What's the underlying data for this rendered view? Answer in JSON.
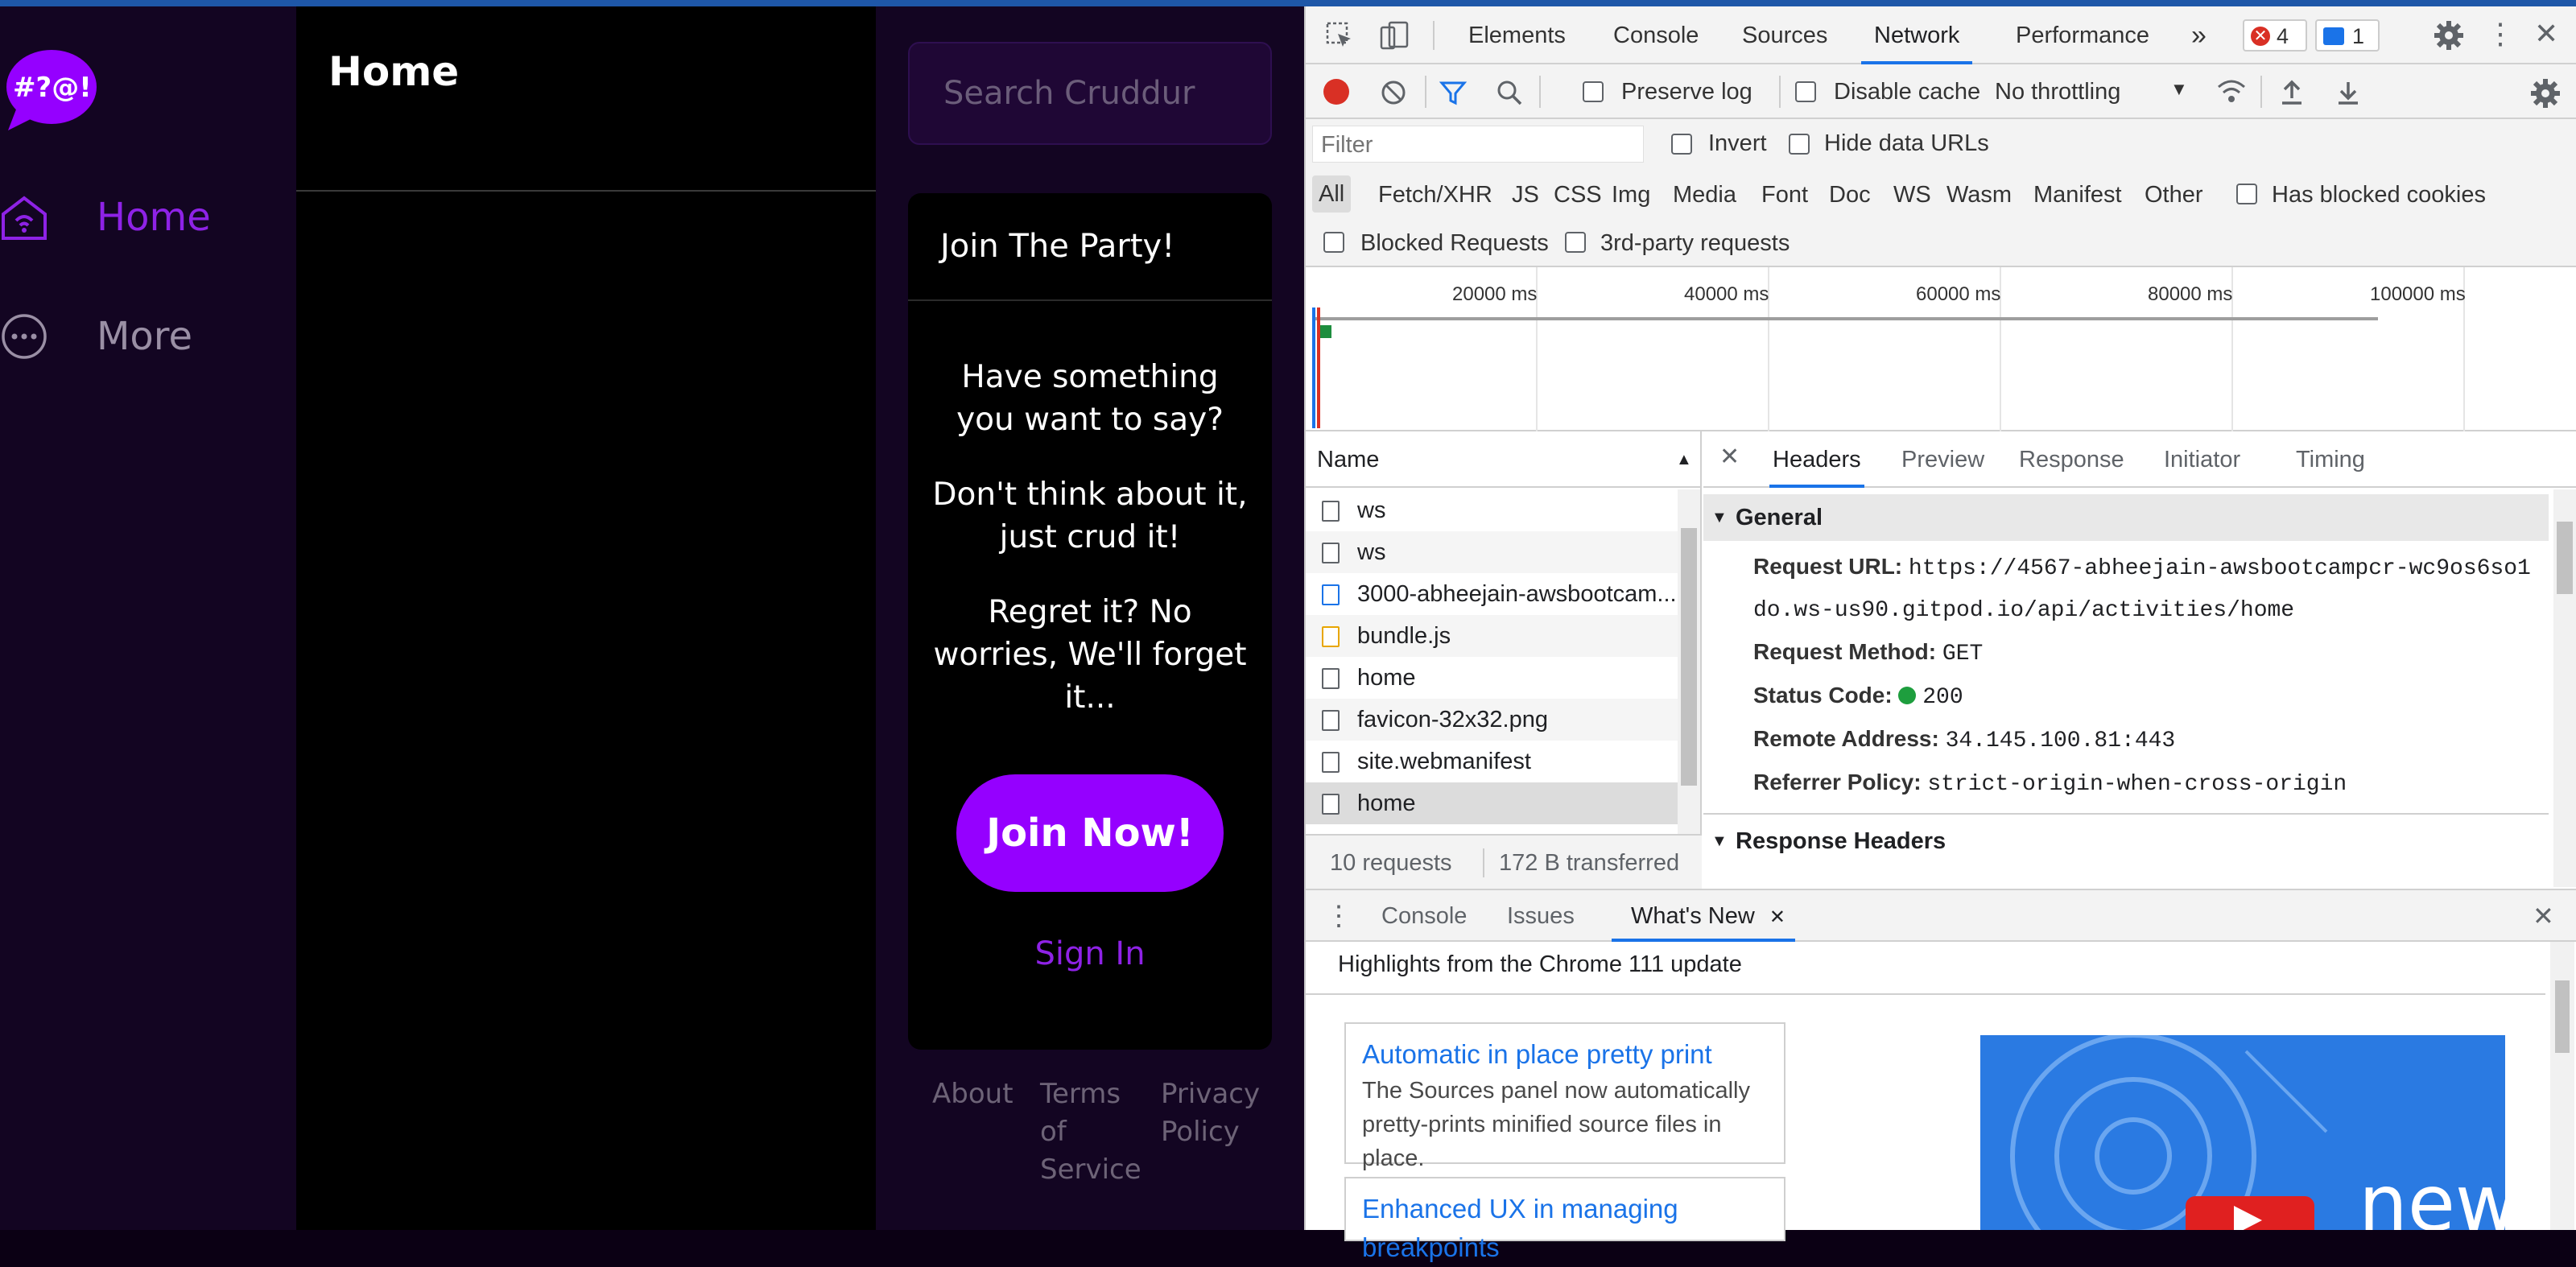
{
  "app": {
    "nav": [
      {
        "label": "Home",
        "icon": "home-icon"
      },
      {
        "label": "More",
        "icon": "more-icon"
      }
    ],
    "feed_title": "Home",
    "search_placeholder": "Search Cruddur",
    "join": {
      "title": "Join The Party!",
      "p1": "Have something you want to say?",
      "p2": "Don't think about it, just crud it!",
      "p3": "Regret it? No worries, We'll forget it...",
      "button": "Join Now!",
      "signin": "Sign In"
    },
    "footer": {
      "about": "About",
      "terms": "Terms of Service",
      "privacy": "Privacy Policy"
    },
    "colors": {
      "accent": "#9500ff",
      "purple_text": "#8e22e6"
    }
  },
  "devtools": {
    "tabs": [
      "Elements",
      "Console",
      "Sources",
      "Network",
      "Performance"
    ],
    "active_tab": "Network",
    "error_count": "4",
    "message_count": "1",
    "toolbar": {
      "preserve_log": "Preserve log",
      "disable_cache": "Disable cache",
      "throttling": "No throttling"
    },
    "filter": {
      "placeholder": "Filter",
      "invert": "Invert",
      "hide_data": "Hide data URLs"
    },
    "types": [
      "All",
      "Fetch/XHR",
      "JS",
      "CSS",
      "Img",
      "Media",
      "Font",
      "Doc",
      "WS",
      "Wasm",
      "Manifest",
      "Other"
    ],
    "has_blocked_cookies": "Has blocked cookies",
    "blocked_requests": "Blocked Requests",
    "third_party": "3rd-party requests",
    "timeline_labels": [
      "20000 ms",
      "40000 ms",
      "60000 ms",
      "80000 ms",
      "100000 ms"
    ],
    "name_header": "Name",
    "requests": [
      "ws",
      "ws",
      "3000-abheejain-awsbootcam...",
      "bundle.js",
      "home",
      "favicon-32x32.png",
      "site.webmanifest",
      "home"
    ],
    "summary_requests": "10 requests",
    "summary_transferred": "172 B transferred",
    "detail_tabs": [
      "Headers",
      "Preview",
      "Response",
      "Initiator",
      "Timing"
    ],
    "general_title": "General",
    "general": {
      "url_key": "Request URL:",
      "url_val_1": "https://4567-abheejain-awsbootcampcr-wc9os6so1",
      "url_val_2": "do.ws-us90.gitpod.io/api/activities/home",
      "method_key": "Request Method:",
      "method_val": "GET",
      "status_key": "Status Code:",
      "status_val": "200",
      "remote_key": "Remote Address:",
      "remote_val": "34.145.100.81:443",
      "referrer_key": "Referrer Policy:",
      "referrer_val": "strict-origin-when-cross-origin"
    },
    "response_headers_title": "Response Headers",
    "drawer_tabs": [
      "Console",
      "Issues",
      "What's New"
    ],
    "whats_new": {
      "highlight": "Highlights from the Chrome 111 update",
      "card1_title": "Automatic in place pretty print",
      "card1_desc": "The Sources panel now automatically pretty-prints minified source files in place.",
      "card2_title": "Enhanced UX in managing breakpoints",
      "video_text": "new"
    }
  }
}
